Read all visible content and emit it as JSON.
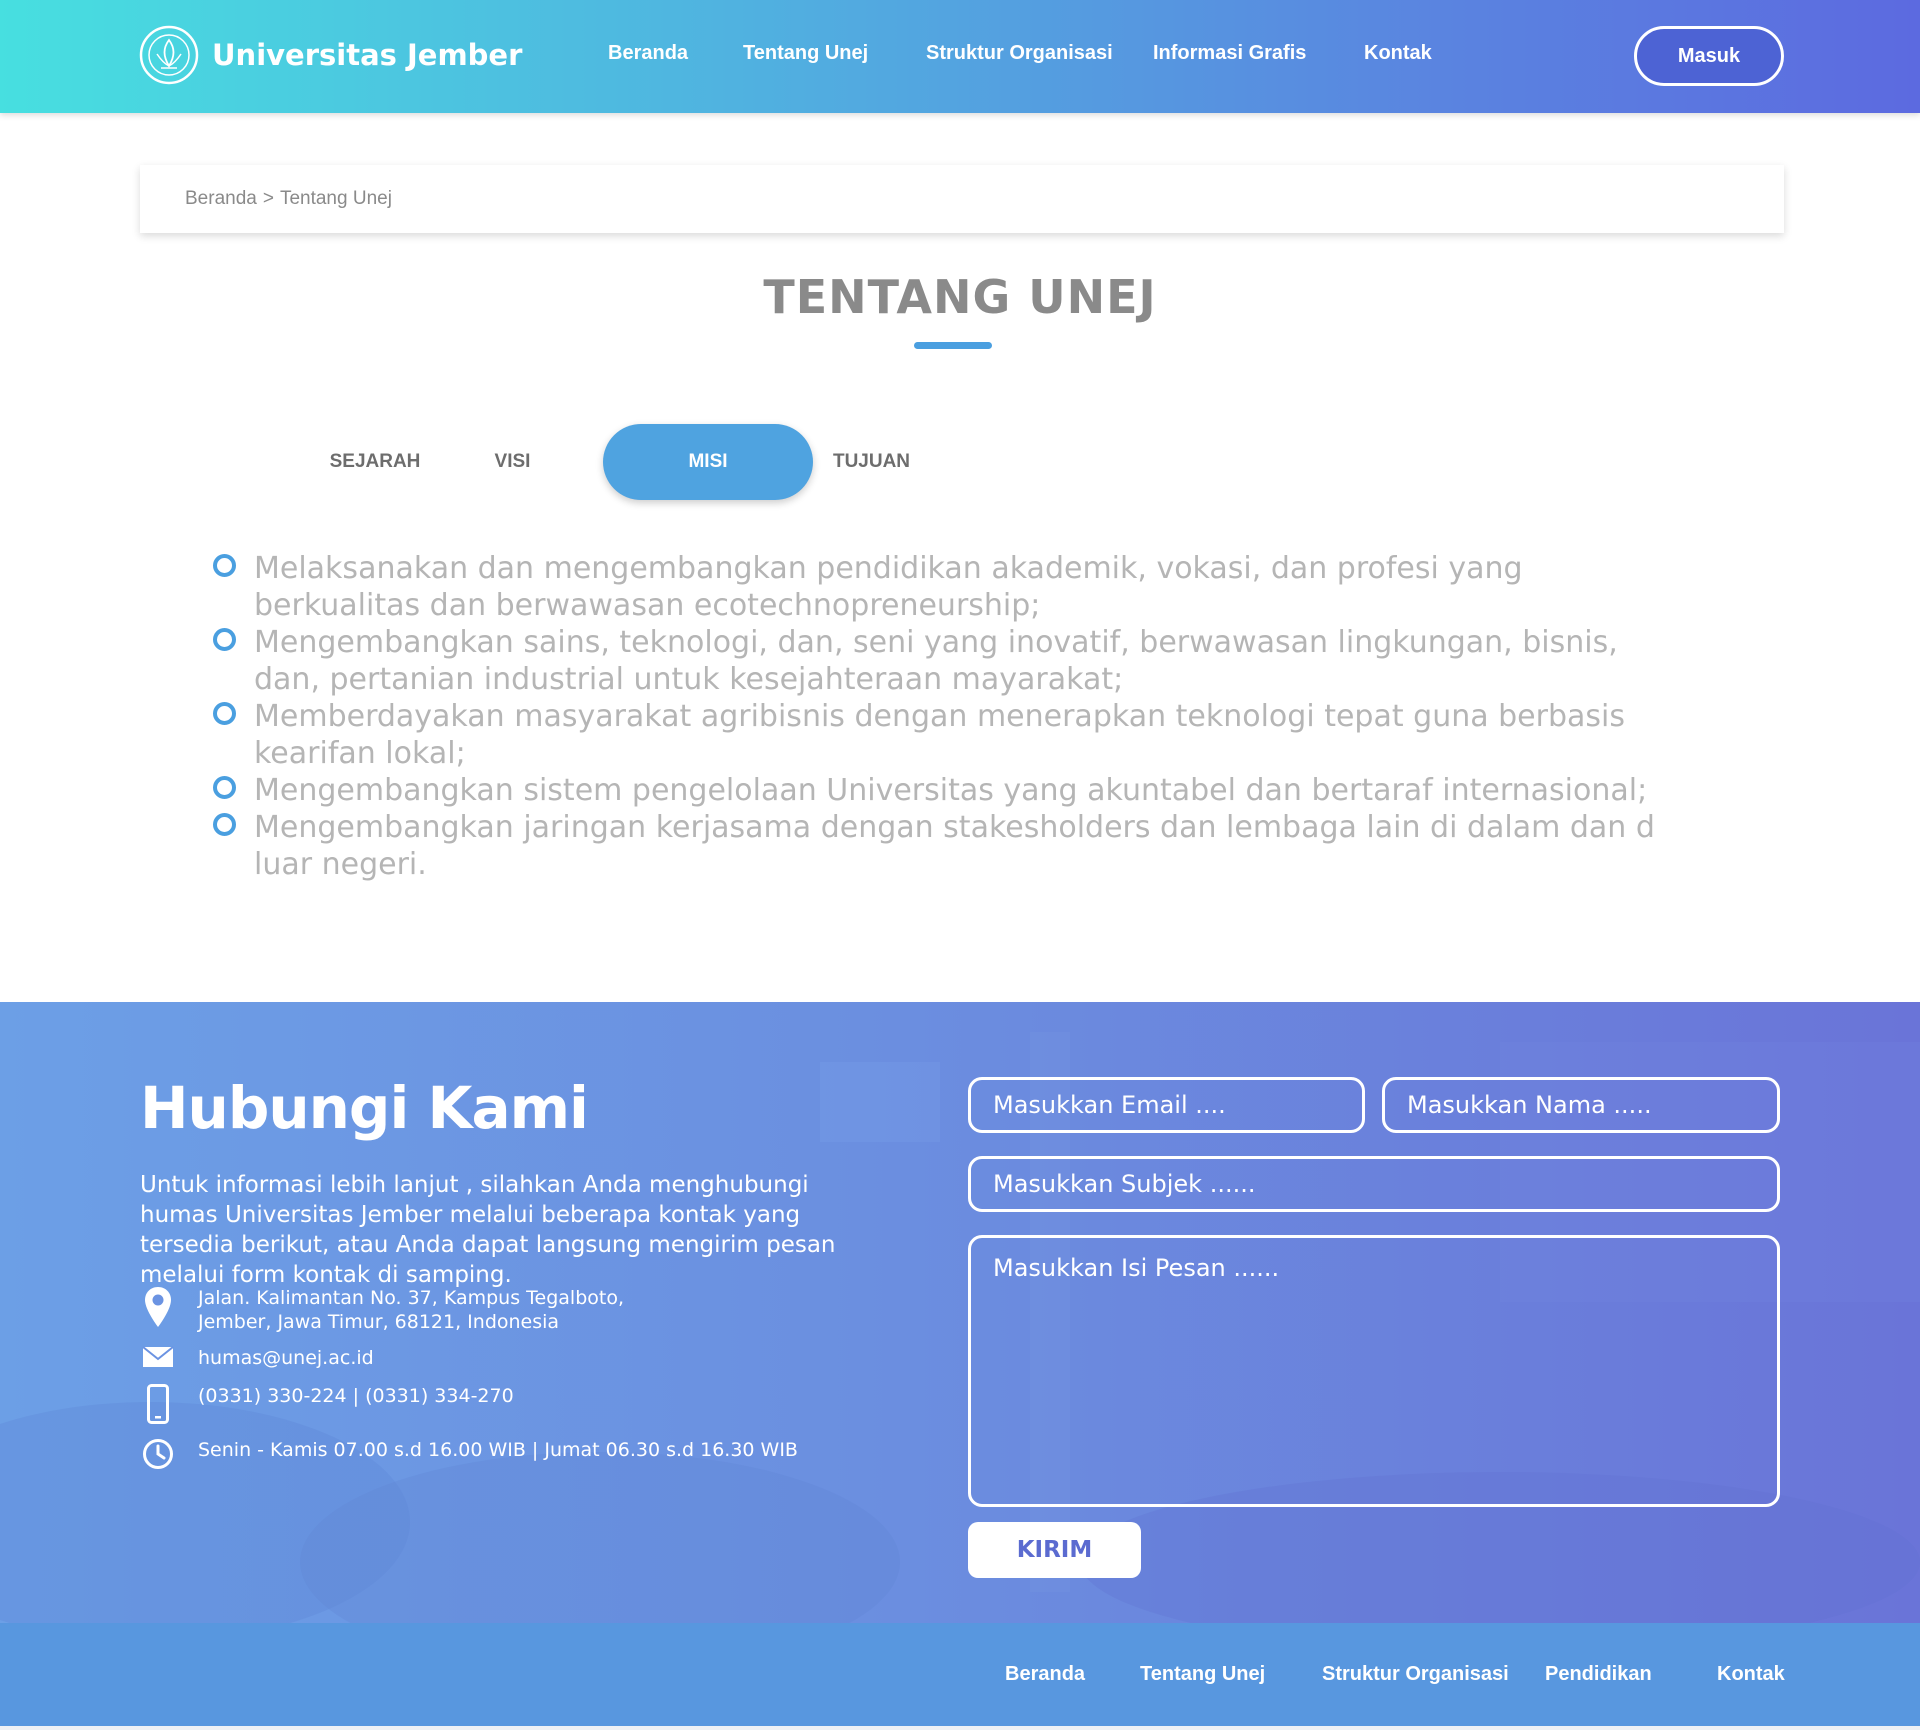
{
  "header": {
    "brand_name": "Universitas Jember",
    "nav": [
      "Beranda",
      "Tentang Unej",
      "Struktur Organisasi",
      "Informasi Grafis",
      "Kontak"
    ],
    "login_label": "Masuk"
  },
  "breadcrumb": {
    "home": "Beranda",
    "separator": ">",
    "current": "Tentang Unej"
  },
  "page": {
    "title": "TENTANG UNEJ",
    "tabs": [
      "SEJARAH",
      "VISI",
      "MISI",
      "TUJUAN"
    ],
    "active_tab": "MISI",
    "misi": [
      "Melaksanakan dan mengembangkan pendidikan akademik, vokasi, dan profesi yang berkualitas dan berwawasan ecotechnopreneurship;",
      "Mengembangkan sains, teknologi, dan, seni yang inovatif, berwawasan lingkungan, bisnis, dan, pertanian industrial untuk kesejahteraan mayarakat;",
      "Memberdayakan masyarakat agribisnis dengan menerapkan teknologi tepat guna berbasis kearifan lokal;",
      "Mengembangkan sistem pengelolaan Universitas yang akuntabel dan bertaraf internasional;",
      "Mengembangkan jaringan kerjasama dengan stakesholders dan lembaga lain di dalam dan d luar negeri."
    ]
  },
  "contact": {
    "title": "Hubungi Kami",
    "description": "Untuk informasi lebih lanjut , silahkan Anda menghubungi humas Universitas Jember melalui beberapa kontak yang tersedia berikut, atau Anda dapat langsung mengirim pesan melalui form kontak di samping.",
    "address_line1": "Jalan. Kalimantan No. 37, Kampus Tegalboto,",
    "address_line2": "Jember, Jawa Timur, 68121, Indonesia",
    "email": "humas@unej.ac.id",
    "phone": "(0331) 330-224 | (0331) 334-270",
    "hours": "Senin - Kamis 07.00 s.d 16.00 WIB | Jumat 06.30 s.d 16.30 WIB",
    "form": {
      "email_placeholder": "Masukkan Email ....",
      "name_placeholder": "Masukkan Nama .....",
      "subject_placeholder": "Masukkan Subjek ......",
      "message_placeholder": "Masukkan Isi Pesan ......",
      "submit_label": "KIRIM"
    }
  },
  "footer": {
    "nav": [
      "Beranda",
      "Tentang Unej",
      "Struktur Organisasi",
      "Pendidikan",
      "Kontak"
    ]
  },
  "icons": {
    "logo": "university-seal-icon",
    "bullet": "circle-outline-icon",
    "address": "map-pin-icon",
    "email": "envelope-icon",
    "phone": "mobile-phone-icon",
    "hours": "clock-icon"
  },
  "colors": {
    "header_gradient_start": "#47dfe0",
    "header_gradient_end": "#5c6ae0",
    "accent": "#4fa3e0",
    "footer": "#5897df",
    "contact_bg": "#6b8fe0"
  }
}
